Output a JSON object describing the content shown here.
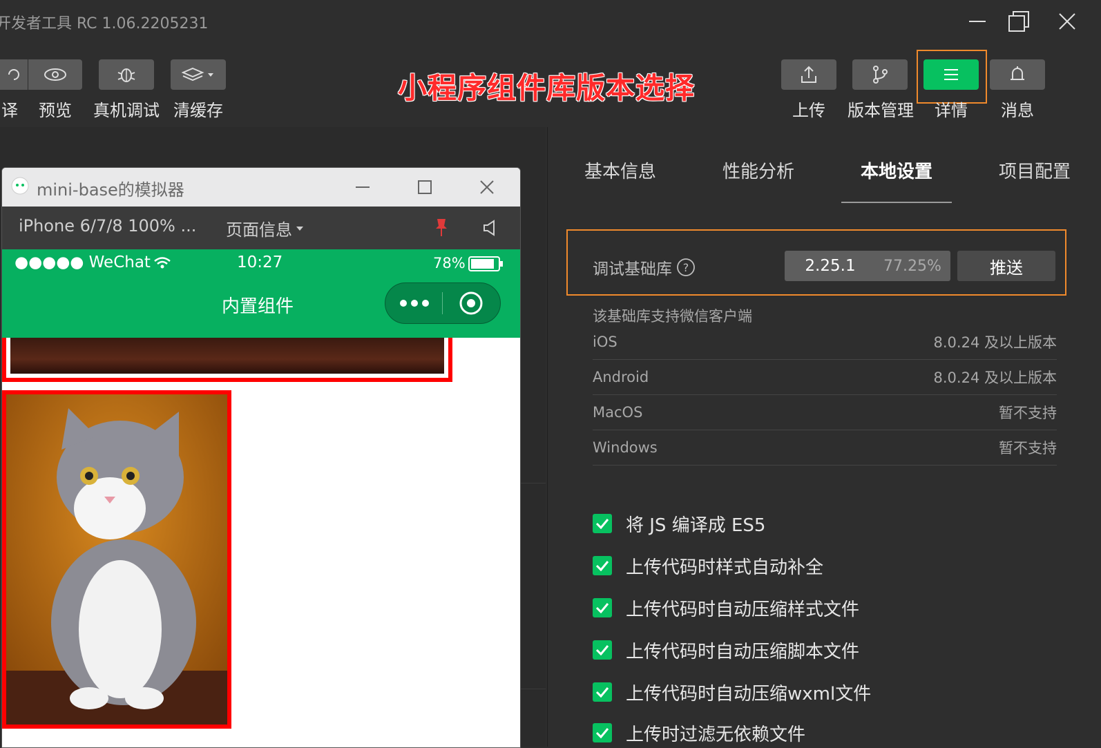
{
  "window": {
    "title": "开发者工具 RC 1.06.2205231"
  },
  "toolbar": {
    "left_buttons": [
      {
        "label": "译",
        "icon": "compile-icon"
      },
      {
        "label": "预览",
        "icon": "eye-icon"
      },
      {
        "label": "真机调试",
        "icon": "bug-icon"
      },
      {
        "label": "清缓存",
        "icon": "layers-icon"
      }
    ],
    "headline": "小程序组件库版本选择",
    "right_buttons": [
      {
        "label": "上传",
        "icon": "upload-icon"
      },
      {
        "label": "版本管理",
        "icon": "branch-icon"
      },
      {
        "label": "详情",
        "icon": "menu-icon"
      },
      {
        "label": "消息",
        "icon": "bell-icon"
      }
    ],
    "accent": "#07c160"
  },
  "simulator": {
    "window_title": "mini-base的模拟器",
    "device": "iPhone 6/7/8 100% ...",
    "page_info": "页面信息",
    "status": {
      "carrier": "●●●●● WeChat",
      "time": "10:27",
      "battery": "78%"
    },
    "nav_title": "内置组件"
  },
  "panel": {
    "tabs": [
      {
        "label": "基本信息"
      },
      {
        "label": "性能分析"
      },
      {
        "label": "本地设置",
        "active": true
      },
      {
        "label": "项目配置"
      }
    ],
    "debug_lib": {
      "label": "调试基础库",
      "version": "2.25.1",
      "coverage": "77.25%",
      "push": "推送"
    },
    "support_note": "该基础库支持微信客户端",
    "support": [
      {
        "os": "iOS",
        "value": "8.0.24 及以上版本"
      },
      {
        "os": "Android",
        "value": "8.0.24 及以上版本"
      },
      {
        "os": "MacOS",
        "value": "暂不支持"
      },
      {
        "os": "Windows",
        "value": "暂不支持"
      }
    ],
    "options": [
      {
        "label": "将 JS 编译成 ES5",
        "checked": true
      },
      {
        "label": "上传代码时样式自动补全",
        "checked": true
      },
      {
        "label": "上传代码时自动压缩样式文件",
        "checked": true
      },
      {
        "label": "上传代码时自动压缩脚本文件",
        "checked": true
      },
      {
        "label": "上传代码时自动压缩wxml文件",
        "checked": true
      },
      {
        "label": "上传时过滤无依赖文件",
        "checked": true
      }
    ]
  }
}
